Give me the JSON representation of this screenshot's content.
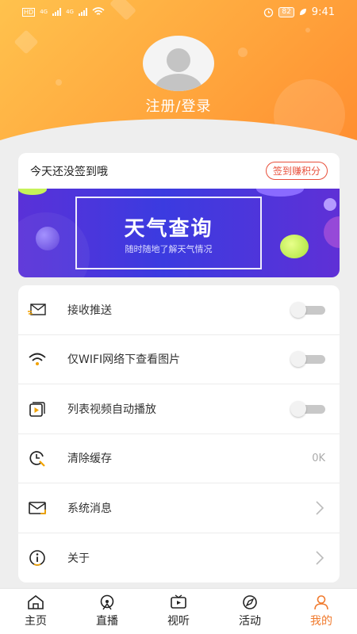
{
  "status_bar": {
    "network_left": "HD",
    "signal_label_1": "4G",
    "signal_label_2": "4G",
    "battery": "82",
    "time": "9:41"
  },
  "profile": {
    "login_label": "注册/登录"
  },
  "sign_card": {
    "hint": "今天还没签到哦",
    "button_label": "签到赚积分"
  },
  "banner": {
    "title": "天气查询",
    "subtitle": "随时随地了解天气情况"
  },
  "settings": {
    "items": [
      {
        "label": "接收推送",
        "icon": "envelope-icon",
        "control": "toggle",
        "on": false
      },
      {
        "label": "仅WIFI网络下查看图片",
        "icon": "wifi-icon",
        "control": "toggle",
        "on": false
      },
      {
        "label": "列表视频自动播放",
        "icon": "video-icon",
        "control": "toggle",
        "on": false
      },
      {
        "label": "清除缓存",
        "icon": "clock-icon",
        "control": "value",
        "value": "0K"
      },
      {
        "label": "系统消息",
        "icon": "mail-icon",
        "control": "chevron"
      },
      {
        "label": "关于",
        "icon": "info-icon",
        "control": "chevron"
      }
    ]
  },
  "nav": {
    "tabs": [
      {
        "label": "主页",
        "icon": "home-icon"
      },
      {
        "label": "直播",
        "icon": "broadcast-icon"
      },
      {
        "label": "视听",
        "icon": "tv-icon"
      },
      {
        "label": "活动",
        "icon": "compass-icon"
      },
      {
        "label": "我的",
        "icon": "user-icon",
        "active": true
      }
    ]
  },
  "colors": {
    "accent": "#f07a2d",
    "header_start": "#ffc24d",
    "header_end": "#ff8a2e",
    "sign_button": "#e84f3a",
    "banner": "#3b3be0"
  }
}
